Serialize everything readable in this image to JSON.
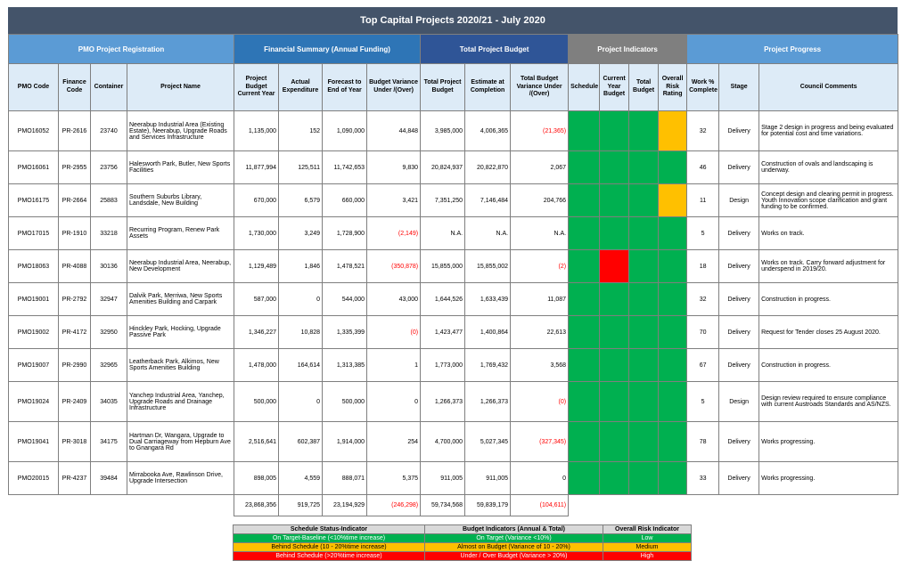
{
  "title": "Top Capital Projects 2020/21 - July 2020",
  "colors": {
    "green": "#00b050",
    "yellow": "#ffc000",
    "red": "#ff0000"
  },
  "groups": {
    "pmo": "PMO Project Registration",
    "financial": "Financial Summary (Annual Funding)",
    "total": "Total Project Budget",
    "indicators": "Project Indicators",
    "progress": "Project Progress"
  },
  "columns": {
    "pmo_code": "PMO Code",
    "finance_code": "Finance Code",
    "container": "Container",
    "project_name": "Project Name",
    "budget_current_year": "Project Budget Current Year",
    "actual_expenditure": "Actual Expenditure",
    "forecast": "Forecast to End of Year",
    "budget_variance": "Budget Variance Under /(Over)",
    "total_project_budget": "Total Project Budget",
    "estimate_completion": "Estimate at Completion",
    "total_budget_variance": "Total Budget Variance Under /(Over)",
    "schedule": "Schedule",
    "current_year_budget": "Current Year Budget",
    "total_budget": "Total Budget",
    "overall_risk": "Overall Risk Rating",
    "work_complete": "Work % Complete",
    "stage": "Stage",
    "council_comments": "Council Comments"
  },
  "rows": [
    {
      "pmo": "PMO16052",
      "fin": "PR-2616",
      "cont": "23740",
      "name": "Neerabup Industrial Area (Existing Estate), Neerabup, Upgrade Roads and Services Infrastructure",
      "bcy": "1,135,000",
      "act": "152",
      "fc": "1,090,000",
      "bv": "44,848",
      "tpb": "3,985,000",
      "eac": "4,006,365",
      "tbv": "(21,365)",
      "sch": "green",
      "cyb": "green",
      "tb": "green",
      "risk": "yellow",
      "pct": "32",
      "stage": "Delivery",
      "comment": "Stage 2 design in progress and being evaluated for potential cost and time variations."
    },
    {
      "pmo": "PMO16061",
      "fin": "PR-2955",
      "cont": "23756",
      "name": "Halesworth Park, Butler, New Sports Facilities",
      "bcy": "11,877,994",
      "act": "125,511",
      "fc": "11,742,653",
      "bv": "9,830",
      "tpb": "20,824,937",
      "eac": "20,822,870",
      "tbv": "2,067",
      "sch": "green",
      "cyb": "green",
      "tb": "green",
      "risk": "green",
      "pct": "46",
      "stage": "Delivery",
      "comment": "Construction of ovals and landscaping is underway."
    },
    {
      "pmo": "PMO16175",
      "fin": "PR-2664",
      "cont": "25883",
      "name": "Southern Suburbs Library, Landsdale, New Building",
      "bcy": "670,000",
      "act": "6,579",
      "fc": "660,000",
      "bv": "3,421",
      "tpb": "7,351,250",
      "eac": "7,146,484",
      "tbv": "204,766",
      "sch": "green",
      "cyb": "green",
      "tb": "green",
      "risk": "yellow",
      "pct": "11",
      "stage": "Design",
      "comment": "Concept design and clearing permit in progress. Youth Innovation scope clarification and grant funding to be confirmed."
    },
    {
      "pmo": "PMO17015",
      "fin": "PR-1910",
      "cont": "33218",
      "name": "Recurring Program, Renew Park Assets",
      "bcy": "1,730,000",
      "act": "3,249",
      "fc": "1,728,900",
      "bv": "(2,149)",
      "tpb": "N.A.",
      "eac": "N.A.",
      "tbv": "N.A.",
      "sch": "green",
      "cyb": "green",
      "tb": "green",
      "risk": "green",
      "pct": "5",
      "stage": "Delivery",
      "comment": "Works on track."
    },
    {
      "pmo": "PMO18063",
      "fin": "PR-4088",
      "cont": "30136",
      "name": "Neerabup Industrial Area, Neerabup, New Development",
      "bcy": "1,129,489",
      "act": "1,846",
      "fc": "1,478,521",
      "bv": "(350,878)",
      "tpb": "15,855,000",
      "eac": "15,855,002",
      "tbv": "(2)",
      "sch": "green",
      "cyb": "red",
      "tb": "green",
      "risk": "green",
      "pct": "18",
      "stage": "Delivery",
      "comment": "Works on track. Carry forward adjustment for underspend in 2019/20."
    },
    {
      "pmo": "PMO19001",
      "fin": "PR-2792",
      "cont": "32947",
      "name": "Dalvik Park, Merriwa, New Sports Amenities Building and Carpark",
      "bcy": "587,000",
      "act": "0",
      "fc": "544,000",
      "bv": "43,000",
      "tpb": "1,644,526",
      "eac": "1,633,439",
      "tbv": "11,087",
      "sch": "green",
      "cyb": "green",
      "tb": "green",
      "risk": "green",
      "pct": "32",
      "stage": "Delivery",
      "comment": "Construction in progress."
    },
    {
      "pmo": "PMO19002",
      "fin": "PR-4172",
      "cont": "32950",
      "name": "Hinckley Park, Hocking, Upgrade Passive Park",
      "bcy": "1,346,227",
      "act": "10,828",
      "fc": "1,335,399",
      "bv": "(0)",
      "tpb": "1,423,477",
      "eac": "1,400,864",
      "tbv": "22,613",
      "sch": "green",
      "cyb": "green",
      "tb": "green",
      "risk": "green",
      "pct": "70",
      "stage": "Delivery",
      "comment": "Request for Tender closes 25 August 2020."
    },
    {
      "pmo": "PMO19007",
      "fin": "PR-2990",
      "cont": "32965",
      "name": "Leatherback Park, Alkimos, New Sports Amenities Building",
      "bcy": "1,478,000",
      "act": "164,614",
      "fc": "1,313,385",
      "bv": "1",
      "tpb": "1,773,000",
      "eac": "1,769,432",
      "tbv": "3,568",
      "sch": "green",
      "cyb": "green",
      "tb": "green",
      "risk": "green",
      "pct": "67",
      "stage": "Delivery",
      "comment": "Construction in progress."
    },
    {
      "pmo": "PMO19024",
      "fin": "PR-2409",
      "cont": "34035",
      "name": "Yanchep Industrial Area, Yanchep, Upgrade Roads and Drainage Infrastructure",
      "bcy": "500,000",
      "act": "0",
      "fc": "500,000",
      "bv": "0",
      "tpb": "1,266,373",
      "eac": "1,266,373",
      "tbv": "(0)",
      "sch": "green",
      "cyb": "green",
      "tb": "green",
      "risk": "green",
      "pct": "5",
      "stage": "Design",
      "comment": "Design review required to ensure compliance with current Austroads Standards and AS/NZS."
    },
    {
      "pmo": "PMO19041",
      "fin": "PR-3018",
      "cont": "34175",
      "name": "Hartman Dr, Wangara, Upgrade to Dual Carriageway from Hepburn Ave to Gnangara Rd",
      "bcy": "2,516,641",
      "act": "602,387",
      "fc": "1,914,000",
      "bv": "254",
      "tpb": "4,700,000",
      "eac": "5,027,345",
      "tbv": "(327,345)",
      "sch": "green",
      "cyb": "green",
      "tb": "green",
      "risk": "green",
      "pct": "78",
      "stage": "Delivery",
      "comment": "Works progressing."
    },
    {
      "pmo": "PMO20015",
      "fin": "PR-4237",
      "cont": "39484",
      "name": "Mirrabooka Ave, Rawlinson Drive, Upgrade Intersection",
      "bcy": "898,005",
      "act": "4,559",
      "fc": "888,071",
      "bv": "5,375",
      "tpb": "911,005",
      "eac": "911,005",
      "tbv": "0",
      "sch": "green",
      "cyb": "green",
      "tb": "green",
      "risk": "green",
      "pct": "33",
      "stage": "Delivery",
      "comment": "Works progressing."
    }
  ],
  "totals": {
    "bcy": "23,868,356",
    "act": "919,725",
    "fc": "23,194,929",
    "bv": "(246,298)",
    "tpb": "59,734,568",
    "eac": "59,839,179",
    "tbv": "(104,611)"
  },
  "legend": {
    "headers": [
      "Schedule Status-Indicator",
      "Budget Indicators (Annual & Total)",
      "Overall Risk Indicator"
    ],
    "rows": [
      {
        "level": "green",
        "schedule": "On Target-Baseline (<10%time increase)",
        "budget": "On Target (Variance <10%)",
        "risk": "Low"
      },
      {
        "level": "yellow",
        "schedule": "Behind Schedule (10 - 20%time increase)",
        "budget": "Almost on Budget (Variance of 10 - 20%)",
        "risk": "Medium"
      },
      {
        "level": "red",
        "schedule": "Behind Schedule (>20%time increase)",
        "budget": "Under / Over Budget (Variance > 20%)",
        "risk": "High"
      }
    ]
  }
}
